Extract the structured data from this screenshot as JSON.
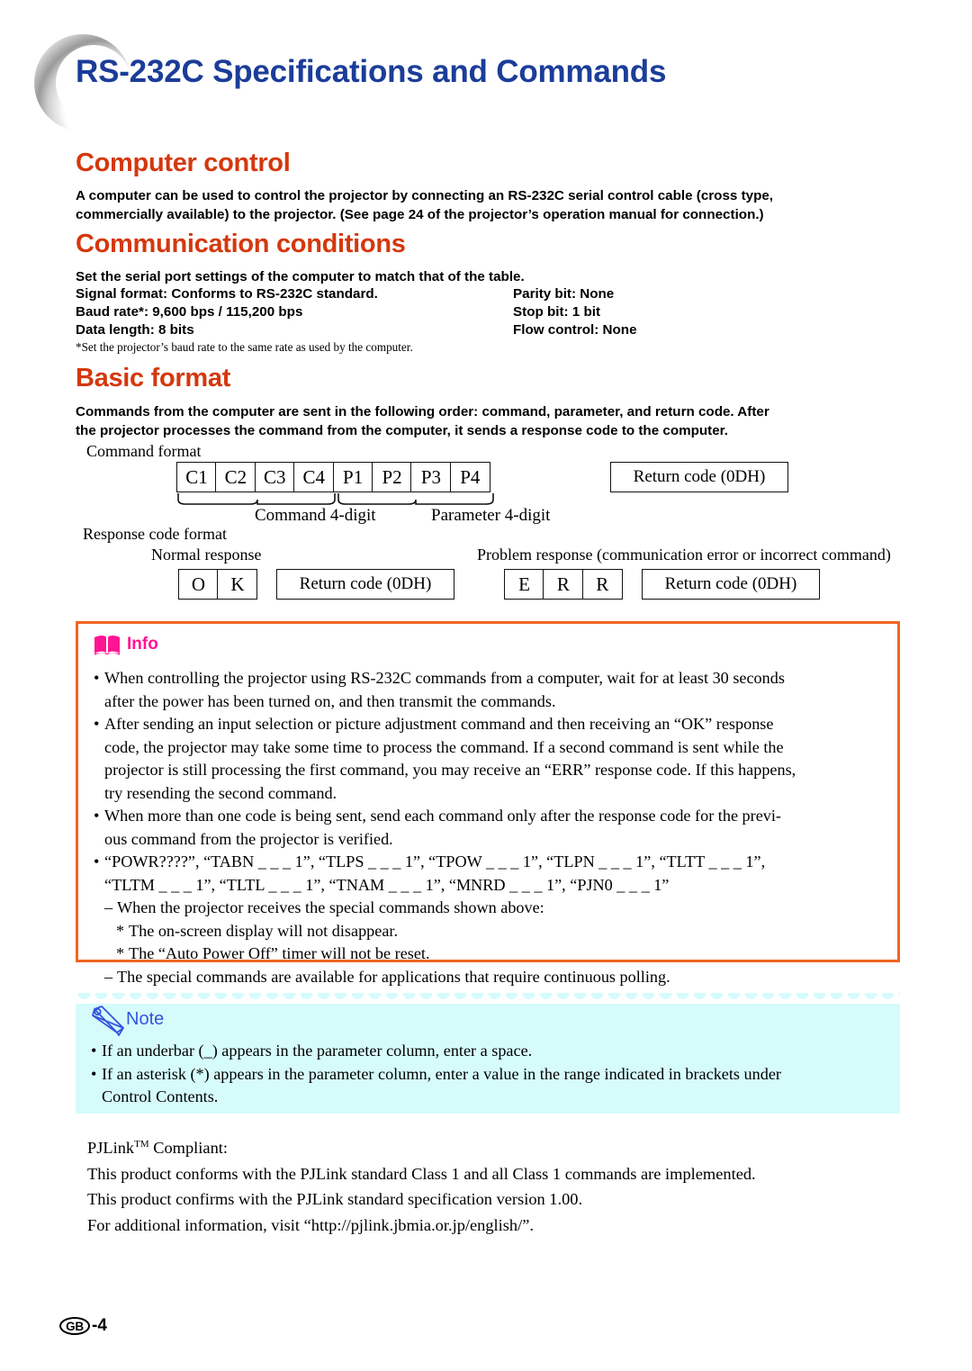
{
  "page": {
    "title": "RS-232C Specifications and Commands",
    "title_color": "#1b3d99",
    "heading_color": "#d4380d"
  },
  "sections": {
    "computer_control": {
      "heading": "Computer control",
      "paragraph_line1": "A computer can be used to control the projector by connecting an RS-232C serial control cable (cross type,",
      "paragraph_line2": "commercially available) to the projector. (See page 24 of the projector’s operation manual for connection.)"
    },
    "communication_conditions": {
      "heading": "Communication conditions",
      "intro": "Set the serial port settings of the computer to match that of the table.",
      "rows": [
        {
          "left": "Signal format: Conforms to RS-232C standard.",
          "right": "Parity bit: None"
        },
        {
          "left": "Baud rate*: 9,600 bps / 115,200 bps",
          "right": "Stop bit: 1 bit"
        },
        {
          "left": "Data length: 8 bits",
          "right": "Flow control: None"
        }
      ],
      "footnote": "*Set the projector’s baud rate to the same rate as used by the computer."
    },
    "basic_format": {
      "heading": "Basic format",
      "paragraph_line1": "Commands from the computer are sent in the following order: command, parameter, and return code. After",
      "paragraph_line2": "the projector processes the command from the computer, it sends a response code to the computer."
    }
  },
  "diagram": {
    "command_format_label": "Command format",
    "command_cells": [
      "C1",
      "C2",
      "C3",
      "C4",
      "P1",
      "P2",
      "P3",
      "P4"
    ],
    "command_brace_label": "Command 4-digit",
    "parameter_brace_label": "Parameter 4-digit",
    "return_code_1": "Return code (0DH)",
    "response_code_format_label": "Response code format",
    "normal_response_label": "Normal response",
    "normal_cells": [
      "O",
      "K"
    ],
    "return_code_2": "Return code (0DH)",
    "problem_response_label": "Problem response (communication error or incorrect command)",
    "problem_cells": [
      "E",
      "R",
      "R"
    ],
    "return_code_3": "Return code (0DH)"
  },
  "info_box": {
    "title": "Info",
    "title_color": "#ff1493",
    "border_color": "#f26522",
    "icon": "open-book-icon",
    "items": [
      "When controlling the projector using RS-232C commands from a computer, wait for at least 30 seconds",
      "after the power has been turned on, and then transmit the commands.",
      "After sending an input selection or picture adjustment command and then receiving an “OK” response",
      "code, the projector may take some time to process the command. If a second command is sent while the",
      "projector is still processing the first command, you may receive an “ERR” response code. If this happens,",
      "try resending the second command.",
      "When more than one code is being sent, send each command only after the response code for the previ-",
      "ous command from the projector is verified.",
      "“POWR????”, “TABN _ _ _ 1”, “TLPS _ _ _ 1”, “TPOW _ _ _ 1”, “TLPN _ _ _ 1”, “TLTT _ _ _ 1”,",
      "“TLTM _ _ _ 1”, “TLTL _ _ _ 1”, “TNAM _ _ _ 1”, “MNRD _ _ _ 1”, “PJN0 _ _ _ 1”",
      "When the projector receives the special commands shown above:",
      "The on-screen display will not disappear.",
      "The “Auto Power Off” timer will not be reset.",
      "The special commands are available for applications that require continuous polling."
    ]
  },
  "note_box": {
    "title": "Note",
    "title_color": "#3355dd",
    "background_color": "#d6fbfb",
    "icon": "pencil-icon",
    "items": [
      "If an underbar (_) appears in the parameter column, enter a space.",
      "If an asterisk (*) appears in the parameter column, enter a value in the range indicated in brackets under",
      "Control Contents."
    ]
  },
  "pjlink": {
    "line1_prefix": "PJLink",
    "line1_sup": "TM",
    "line1_suffix": " Compliant:",
    "line2": "This product conforms with the PJLink standard Class 1 and all Class 1 commands are implemented.",
    "line3": "This product confirms with the PJLink standard specification version 1.00.",
    "line4": "For additional information, visit “http://pjlink.jbmia.or.jp/english/”."
  },
  "footer": {
    "region_code": "GB",
    "page_number": "-4"
  }
}
